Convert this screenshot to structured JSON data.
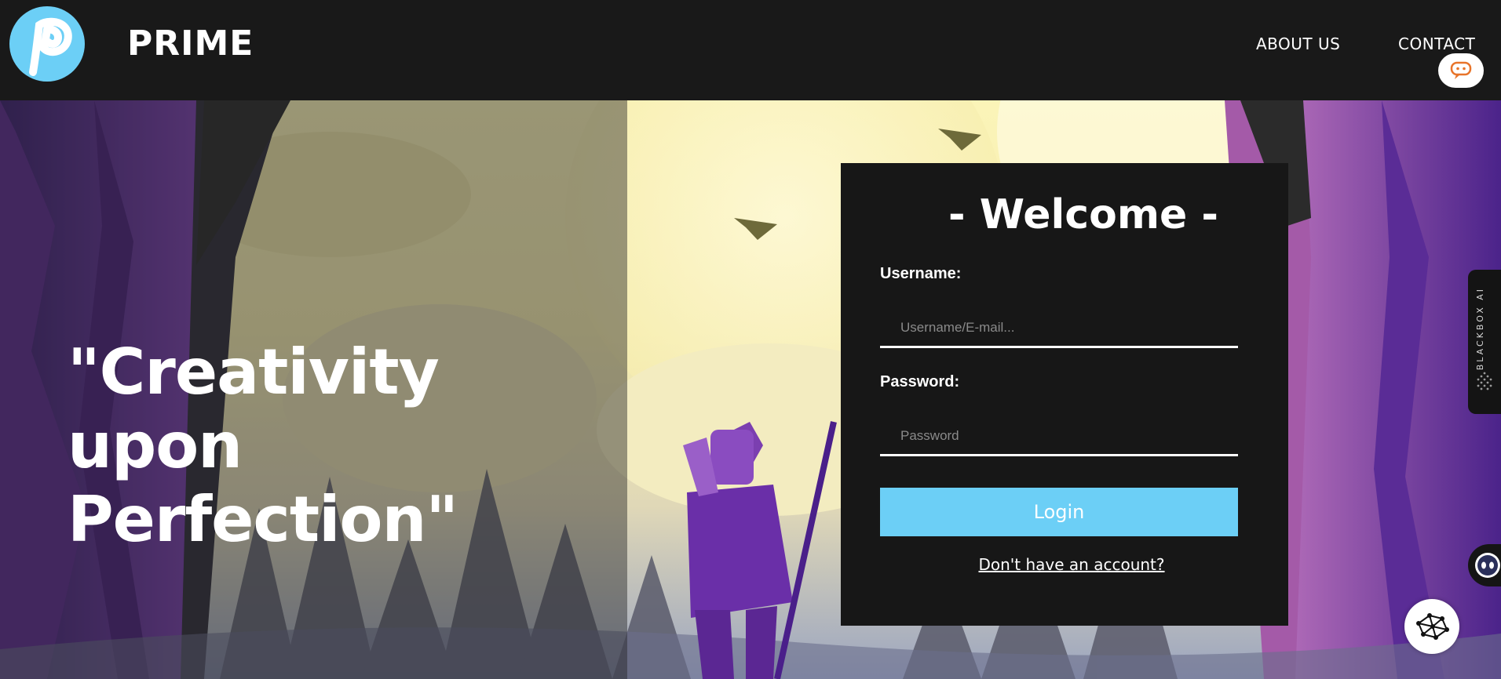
{
  "header": {
    "brand": "PRIME",
    "nav": [
      {
        "label": "ABOUT US"
      },
      {
        "label": "CONTACT"
      }
    ]
  },
  "hero": {
    "tagline": "\"Creativity upon Perfection\""
  },
  "login": {
    "title": "- Welcome -",
    "username_label": "Username:",
    "username_placeholder": "Username/E-mail...",
    "password_label": "Password:",
    "password_placeholder": "Password",
    "button_label": "Login",
    "signup_link": "Don't have an account?"
  },
  "widgets": {
    "blackbox_label": "BLACKBOX AI"
  },
  "colors": {
    "accent": "#6ccff6",
    "header_bg": "#191919",
    "card_bg": "#171717"
  }
}
